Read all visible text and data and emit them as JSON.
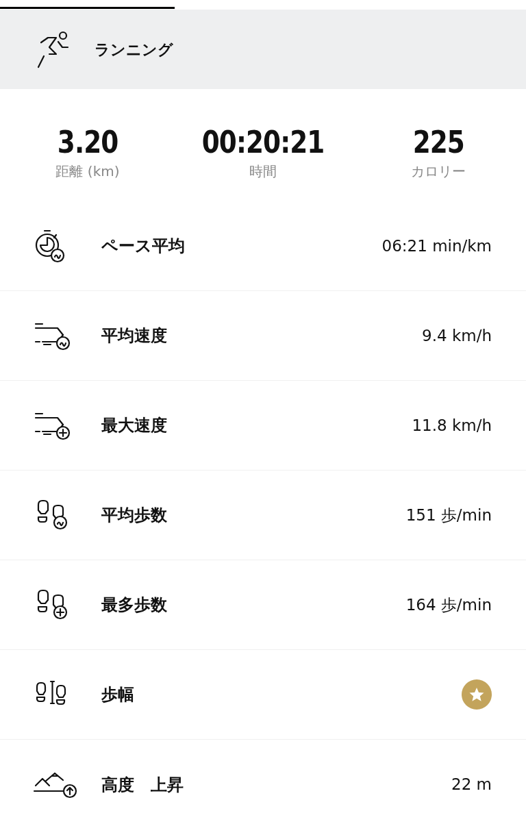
{
  "header": {
    "title": "ランニング"
  },
  "summary": [
    {
      "value": "3.20",
      "label": "距離 (km)"
    },
    {
      "value": "00:20:21",
      "label": "時間"
    },
    {
      "value": "225",
      "label": "カロリー"
    }
  ],
  "metrics": [
    {
      "label": "ペース平均",
      "kind": "text",
      "value": "06:21 min/km"
    },
    {
      "label": "平均速度",
      "kind": "text",
      "value": "9.4 km/h"
    },
    {
      "label": "最大速度",
      "kind": "text",
      "value": "11.8 km/h"
    },
    {
      "label": "平均歩数",
      "kind": "text",
      "value": "151 歩/min"
    },
    {
      "label": "最多歩数",
      "kind": "text",
      "value": "164 歩/min"
    },
    {
      "label": "歩幅",
      "kind": "badge"
    },
    {
      "label": "高度　上昇",
      "kind": "text",
      "value": "22 m"
    }
  ]
}
